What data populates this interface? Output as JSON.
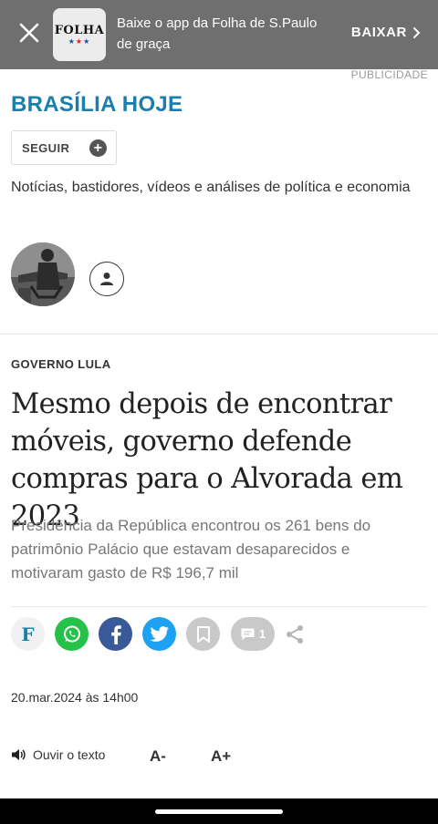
{
  "banner": {
    "logo_text": "FOLHA",
    "text": "Baixe o app da Folha de S.Paulo de graça",
    "cta": "BAIXAR",
    "close_icon": "close-icon",
    "cta_icon": "chevron-right-icon"
  },
  "ad_label": "PUBLICIDADE",
  "column": {
    "title": "BRASÍLIA HOJE",
    "follow_label": "SEGUIR",
    "description": "Notícias, bastidores, vídeos e análises de política e economia"
  },
  "article": {
    "kicker": "GOVERNO LULA",
    "headline": "Mesmo depois de encontrar móveis, governo defende compras para o Alvorada em 2023",
    "subheadline": "Presidência da República encontrou os 261 bens do patrimônio Palácio que estavam desaparecidos e motivaram gasto de R$ 196,7 mil",
    "dateline": "20.mar.2024 às 14h00"
  },
  "share": {
    "folha_label": "F",
    "comments_count": "1"
  },
  "audio": {
    "listen_label": "Ouvir o texto",
    "font_decrease": "A-",
    "font_increase": "A+"
  },
  "colors": {
    "accent": "#1b7fae",
    "banner_bg": "#6f6f6f",
    "whatsapp": "#25c149",
    "facebook": "#3a5998",
    "twitter": "#1da1f2"
  }
}
